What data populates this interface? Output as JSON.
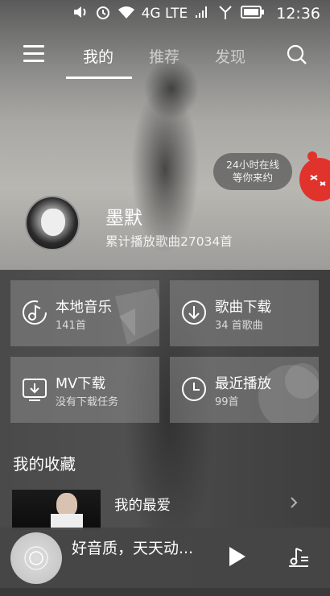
{
  "status_bar": {
    "network": "4G LTE",
    "time": "12:36",
    "icons": [
      "volume-icon",
      "alarm-icon",
      "wifi-icon",
      "signal-icon",
      "signal-2-icon",
      "battery-icon"
    ]
  },
  "nav": {
    "tabs": [
      {
        "label": "我的",
        "active": true
      },
      {
        "label": "推荐",
        "active": false
      },
      {
        "label": "发现",
        "active": false
      }
    ]
  },
  "promo_bubble": {
    "line1": "24小时在线",
    "line2": "等你来约"
  },
  "profile": {
    "name": "墨默",
    "play_count": "累计播放歌曲27034首"
  },
  "tiles": [
    {
      "title": "本地音乐",
      "subtitle": "141首",
      "icon": "music-note-icon"
    },
    {
      "title": "歌曲下载",
      "subtitle": "34 首歌曲",
      "icon": "download-circle-icon"
    },
    {
      "title": "MV下载",
      "subtitle": "没有下载任务",
      "icon": "mv-download-icon"
    },
    {
      "title": "最近播放",
      "subtitle": "99首",
      "icon": "clock-icon"
    }
  ],
  "favorites": {
    "title": "我的收藏",
    "item_label": "我的最爱"
  },
  "player": {
    "now_playing": "好音质，天天动..."
  },
  "colors": {
    "tile_bg": "#969696",
    "mascot": "#e0332c",
    "player_bg": "#464646"
  }
}
